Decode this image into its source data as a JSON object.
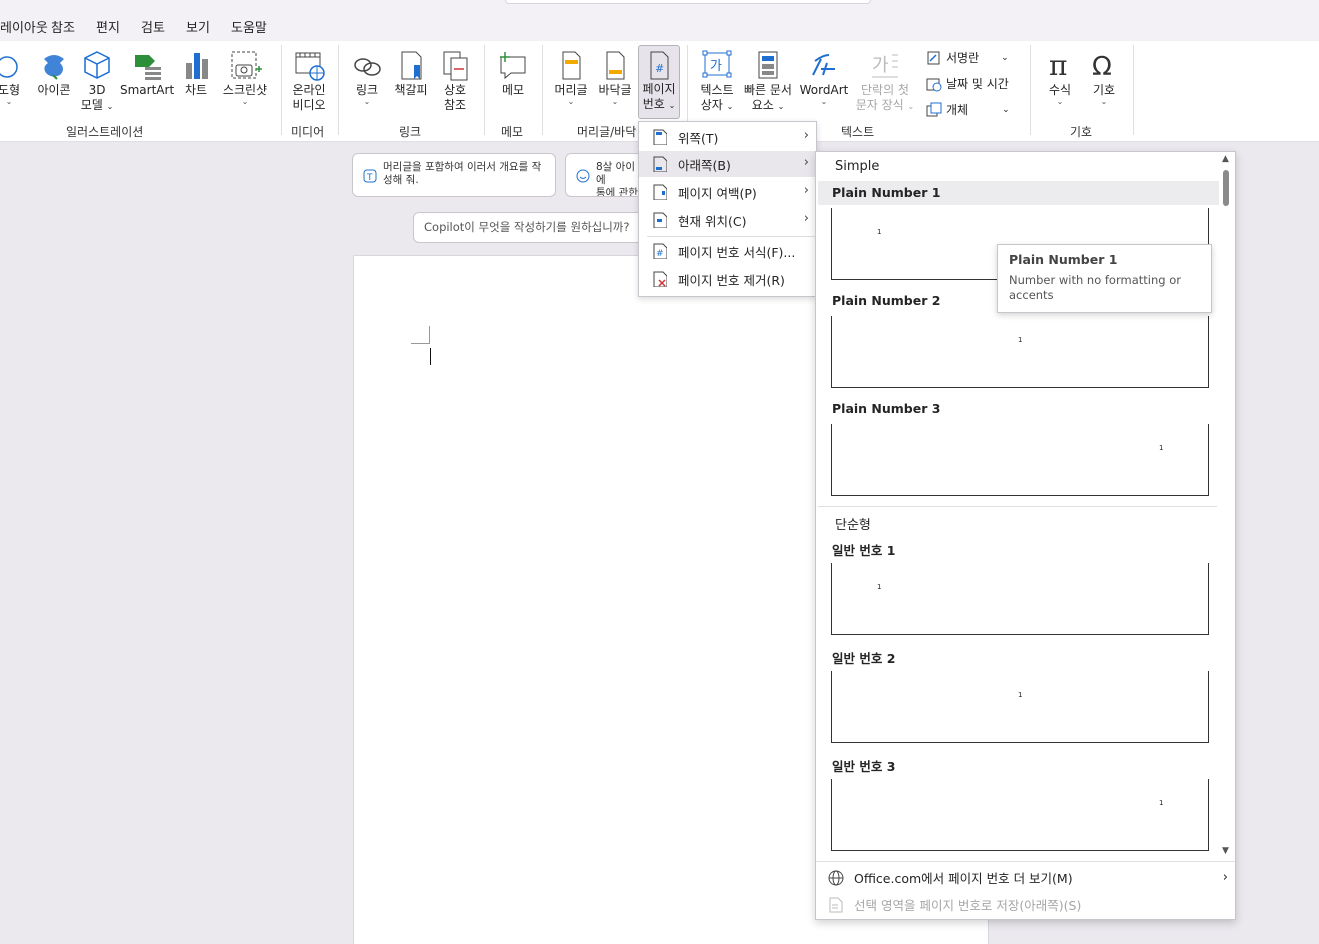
{
  "menu_tabs": [
    "레이아웃",
    "참조",
    "편지",
    "검토",
    "보기",
    "도움말"
  ],
  "ribbon": {
    "illustrations": {
      "shapes": "도형",
      "icons": "아이콘",
      "model3d_line1": "3D",
      "model3d_line2": "모델",
      "smartart": "SmartArt",
      "chart": "차트",
      "screenshot": "스크린샷",
      "group_label": "일러스트레이션"
    },
    "media": {
      "online_video_line1": "온라인",
      "online_video_line2": "비디오",
      "group_label": "미디어"
    },
    "links": {
      "link": "링크",
      "bookmark": "책갈피",
      "crossref_line1": "상호",
      "crossref_line2": "참조",
      "group_label": "링크"
    },
    "comments": {
      "comment": "메모",
      "group_label": "메모"
    },
    "header_footer": {
      "header": "머리글",
      "footer": "바닥글",
      "page_number_line1": "페이지",
      "page_number_line2": "번호",
      "group_label": "머리글/바닥글"
    },
    "text": {
      "textbox_line1": "텍스트",
      "textbox_line2": "상자",
      "quickparts_line1": "빠른 문서",
      "quickparts_line2": "요소",
      "wordart": "WordArt",
      "dropcap_line1": "단락의 첫",
      "dropcap_line2": "문자 장식",
      "signature": "서명란",
      "datetime": "날짜 및 시간",
      "object": "개체",
      "group_label": "텍스트"
    },
    "symbols": {
      "equation": "수식",
      "symbol": "기호",
      "group_label": "기호"
    }
  },
  "prompts": {
    "card1": "머리글을 포함하여 이러서 개요를 작성해 줘.",
    "card2_line1": "8살 아이에",
    "card2_line2": "통에 관한",
    "copilot_placeholder": "Copilot이 무엇을 작성하기를 원하십니까?"
  },
  "page_number_menu": [
    {
      "label": "위쪽(T)",
      "icon": "page-top-icon",
      "submenu": true
    },
    {
      "label": "아래쪽(B)",
      "icon": "page-bottom-icon",
      "submenu": true,
      "highlighted": true
    },
    {
      "label": "페이지 여백(P)",
      "icon": "page-margin-icon",
      "submenu": true
    },
    {
      "label": "현재 위치(C)",
      "icon": "current-position-icon",
      "submenu": true
    },
    {
      "label": "페이지 번호 서식(F)...",
      "icon": "format-page-number-icon",
      "submenu": false
    },
    {
      "label": "페이지 번호 제거(R)",
      "icon": "remove-page-number-icon",
      "submenu": false
    }
  ],
  "gallery": {
    "section_simple": "Simple",
    "section_korean": "단순형",
    "items": [
      {
        "title": "Plain Number 1",
        "number": "1",
        "align": "left"
      },
      {
        "title": "Plain Number 2",
        "number": "1",
        "align": "center"
      },
      {
        "title": "Plain Number 3",
        "number": "1",
        "align": "right"
      },
      {
        "title": "일반 번호 1",
        "number": "1",
        "align": "left"
      },
      {
        "title": "일반 번호 2",
        "number": "1",
        "align": "center"
      },
      {
        "title": "일반 번호 3",
        "number": "1",
        "align": "right"
      }
    ],
    "more_from_office": "Office.com에서 페이지 번호 더 보기(M)",
    "save_selection": "선택 영역을 페이지 번호로 저장(아래쪽)(S)"
  },
  "tooltip": {
    "title": "Plain Number 1",
    "description": "Number with no formatting or accents"
  },
  "colors": {
    "accent_blue": "#1f6fd0",
    "ribbon_bg": "#ffffff",
    "canvas_bg": "#ebe8ee"
  }
}
